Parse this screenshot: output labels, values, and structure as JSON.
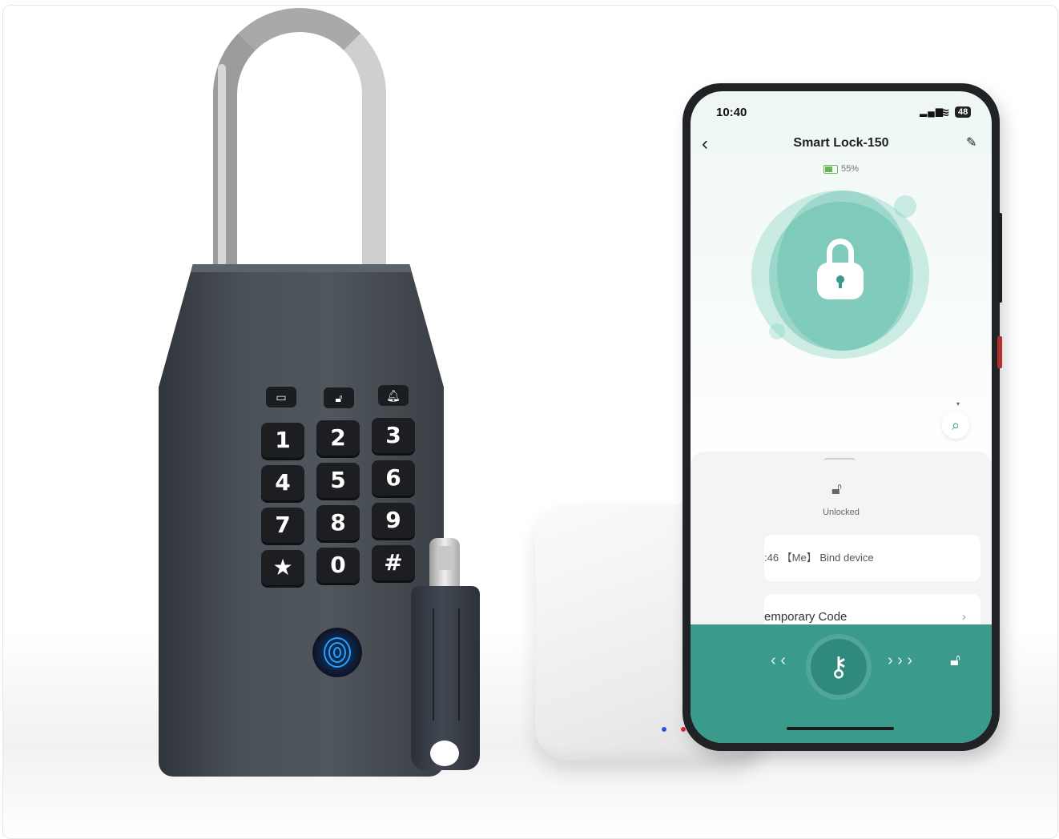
{
  "padlock": {
    "keys": [
      "1",
      "2",
      "3",
      "4",
      "5",
      "6",
      "7",
      "8",
      "9",
      "★",
      "0",
      "#"
    ],
    "indicators": [
      "battery-icon",
      "unlock-icon",
      "alarm-icon"
    ]
  },
  "phone": {
    "status_time": "10:40",
    "battery_badge": "48",
    "title": "Smart Lock-150",
    "battery_percent": "55%",
    "lock_state_label": "Unlocked",
    "records": [
      {
        "text": ":46 【Me】 Bind device"
      },
      {
        "text": "emporary Code"
      }
    ]
  },
  "colors": {
    "accent": "#3a9a8b",
    "lock_body": "#444a51",
    "fingerprint_glow": "#2aa0ff",
    "led_blue": "#2f55e0",
    "led_red": "#e02b2b"
  }
}
